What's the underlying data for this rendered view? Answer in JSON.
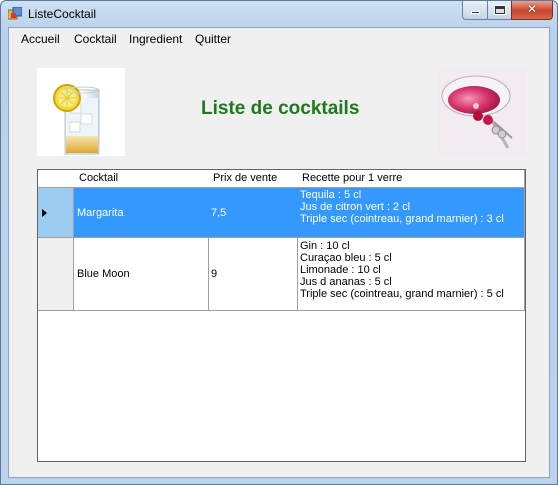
{
  "window": {
    "title": "ListeCocktail"
  },
  "menu": {
    "items": [
      {
        "label": "Accueil"
      },
      {
        "label": "Cocktail"
      },
      {
        "label": "Ingredient"
      },
      {
        "label": "Quitter"
      }
    ]
  },
  "heading": {
    "text": "Liste de cocktails",
    "color": "#1e7a1e"
  },
  "images": {
    "left": "tall-cocktail-lemon-image",
    "right": "martini-glass-cherry-image"
  },
  "grid": {
    "columns": [
      "Cocktail",
      "Prix de vente",
      "Recette pour 1 verre"
    ],
    "rows": [
      {
        "cocktail": "Margarita",
        "prix": "7,5",
        "recette": [
          "Tequila :  5 cl",
          "Jus de citron vert :  2 cl",
          "Triple sec (cointreau, grand marnier) :  3 cl"
        ],
        "selected": true
      },
      {
        "cocktail": "Blue Moon",
        "prix": "9",
        "recette": [
          "Gin :  10 cl",
          "Curaçao bleu :  5 cl",
          "Limonade :  10 cl",
          "Jus d ananas :  5 cl",
          "Triple sec (cointreau, grand marnier) :  5 cl"
        ],
        "selected": false
      }
    ],
    "selection_color": "#3399ff"
  }
}
